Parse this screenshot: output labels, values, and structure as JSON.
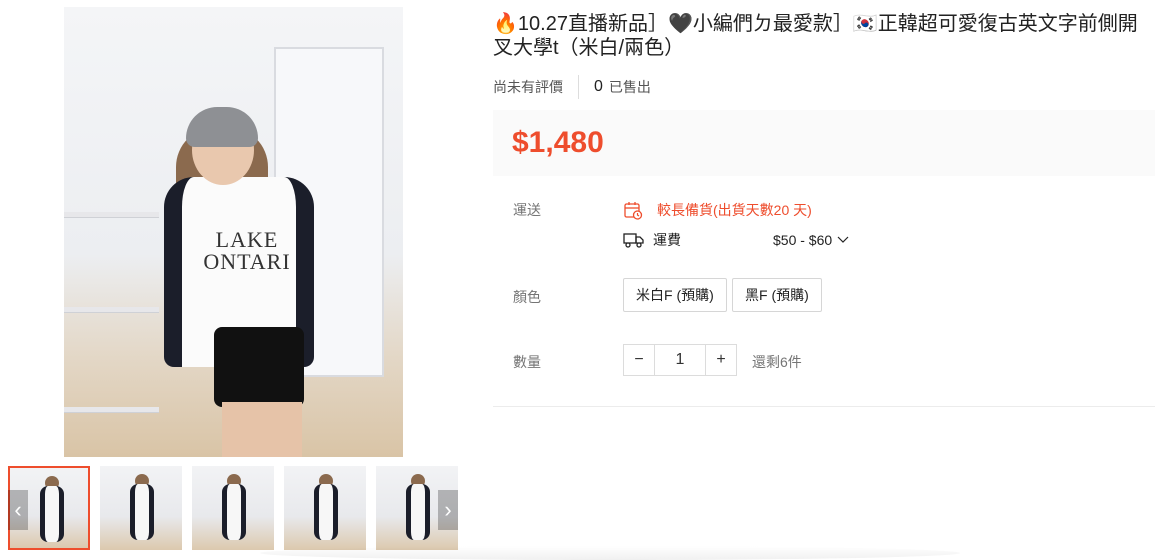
{
  "product": {
    "title": "🔥10.27直播新品］🖤小編們ㄉ最愛款］🇰🇷正韓超可愛復古英文字前側開叉大學t（米白/兩色）",
    "rating_text": "尚未有評價",
    "sold_count": "0",
    "sold_label": "已售出",
    "price": "$1,480",
    "image_text_line1": "LAKE",
    "image_text_line2": "ONTARI"
  },
  "shipping": {
    "label": "運送",
    "preorder_notice": "較長備貨(出貨天數20 天)",
    "fee_label": "運費",
    "fee_value": "$50 - $60"
  },
  "variants": {
    "label": "顏色",
    "options": [
      "米白F (預購)",
      "黑F (預購)"
    ]
  },
  "quantity": {
    "label": "數量",
    "value": "1",
    "minus": "−",
    "plus": "+",
    "stock_text": "還剩6件"
  },
  "gallery": {
    "prev": "‹",
    "next": "›"
  },
  "colors": {
    "accent": "#ee4d2d"
  }
}
